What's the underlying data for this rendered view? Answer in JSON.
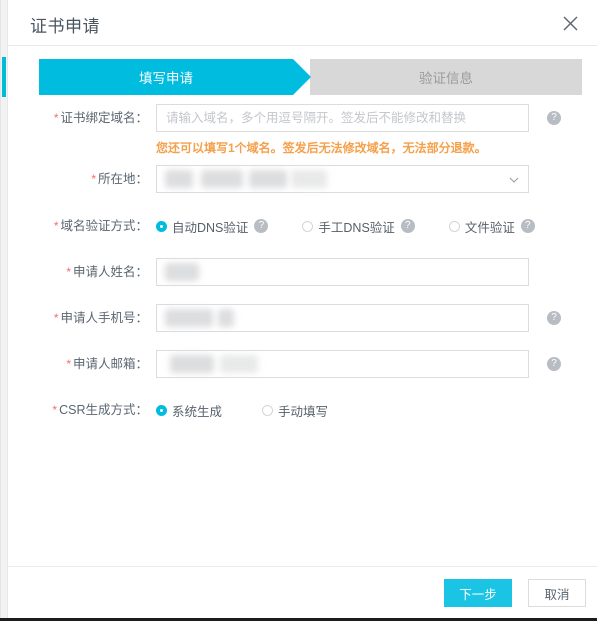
{
  "dialog": {
    "title": "证书申请",
    "close_icon": "close-icon"
  },
  "steps": [
    {
      "label": "填写申请",
      "state": "active"
    },
    {
      "label": "验证信息",
      "state": "inactive"
    }
  ],
  "form": {
    "domain": {
      "label": "证书绑定域名：",
      "required": "*",
      "value": "",
      "placeholder": "请输入域名，多个用逗号隔开。签发后不能修改和替换",
      "help": "?"
    },
    "warning": "您还可以填写1个域名。签发后无法修改域名，无法部分退款。",
    "location": {
      "label": "所在地：",
      "required": "*",
      "value": "",
      "caret_icon": "chevron-down-icon"
    },
    "dns_verify": {
      "label": "域名验证方式：",
      "required": "*",
      "options": [
        {
          "label": "自动DNS验证",
          "selected": true,
          "help": "?"
        },
        {
          "label": "手工DNS验证",
          "selected": false,
          "help": "?"
        },
        {
          "label": "文件验证",
          "selected": false,
          "help": "?"
        }
      ]
    },
    "applicant_name": {
      "label": "申请人姓名：",
      "required": "*",
      "value": "",
      "placeholder": ""
    },
    "applicant_phone": {
      "label": "申请人手机号：",
      "required": "*",
      "value": "",
      "placeholder": "",
      "help": "?"
    },
    "applicant_email": {
      "label": "申请人邮箱：",
      "required": "*",
      "value": "",
      "placeholder": "",
      "help": "?"
    },
    "csr": {
      "label": "CSR生成方式：",
      "required": "*",
      "options": [
        {
          "label": "系统生成",
          "selected": true
        },
        {
          "label": "手动填写",
          "selected": false
        }
      ]
    }
  },
  "footer": {
    "primary": "下一步",
    "cancel": "取消"
  },
  "colors": {
    "accent": "#00bcdf",
    "primary_button": "#1bc4e4",
    "step_inactive": "#d8d8d8",
    "warning": "#f5a04b",
    "required": "#f56c6c"
  }
}
